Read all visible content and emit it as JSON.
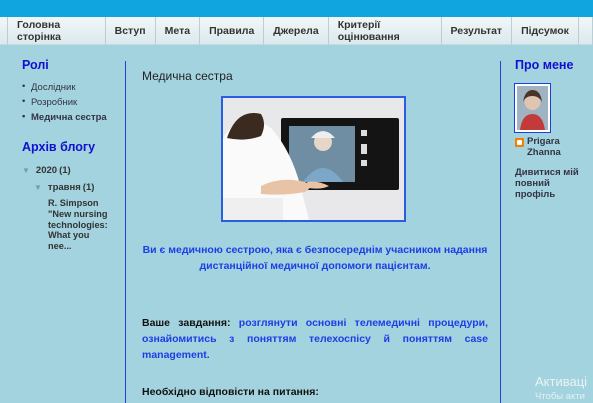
{
  "nav": {
    "tabs": [
      "Головна сторінка",
      "Вступ",
      "Мета",
      "Правила",
      "Джерела",
      "Критерії оцінювання",
      "Результат",
      "Підсумок"
    ]
  },
  "left": {
    "roles_title": "Ролі",
    "roles": [
      "Дослідник",
      "Розробник",
      "Медична сестра"
    ],
    "archive_title": "Архів блогу",
    "year": "2020",
    "year_count": "(1)",
    "month": "травня",
    "month_count": "(1)",
    "post": "R. Simpson \"New nursing technologies: What you nee..."
  },
  "main": {
    "title": "Медична сестра",
    "lead": "Ви є медичною сестрою, яка є безпосереднім учасником надання дистанційної медичної допомоги пацієнтам.",
    "task_label": "Ваше завдання:",
    "task_text": "розглянути основні телемедичні процедури, ознайомитись з поняттям телехоспісу й поняттям case management.",
    "questions": "Необхідно відповісти на питання:"
  },
  "right": {
    "title": "Про мене",
    "name": "Prigara Zhanna",
    "profile_link": "Дивитися мій повний профіль"
  },
  "watermark": {
    "line1": "Активаці",
    "line2": "Чтобы акти"
  },
  "colors": {
    "topbar": "#10a5de",
    "background": "#a3d3de",
    "heading": "#1010d0",
    "accent_text": "#1c3ee6"
  }
}
